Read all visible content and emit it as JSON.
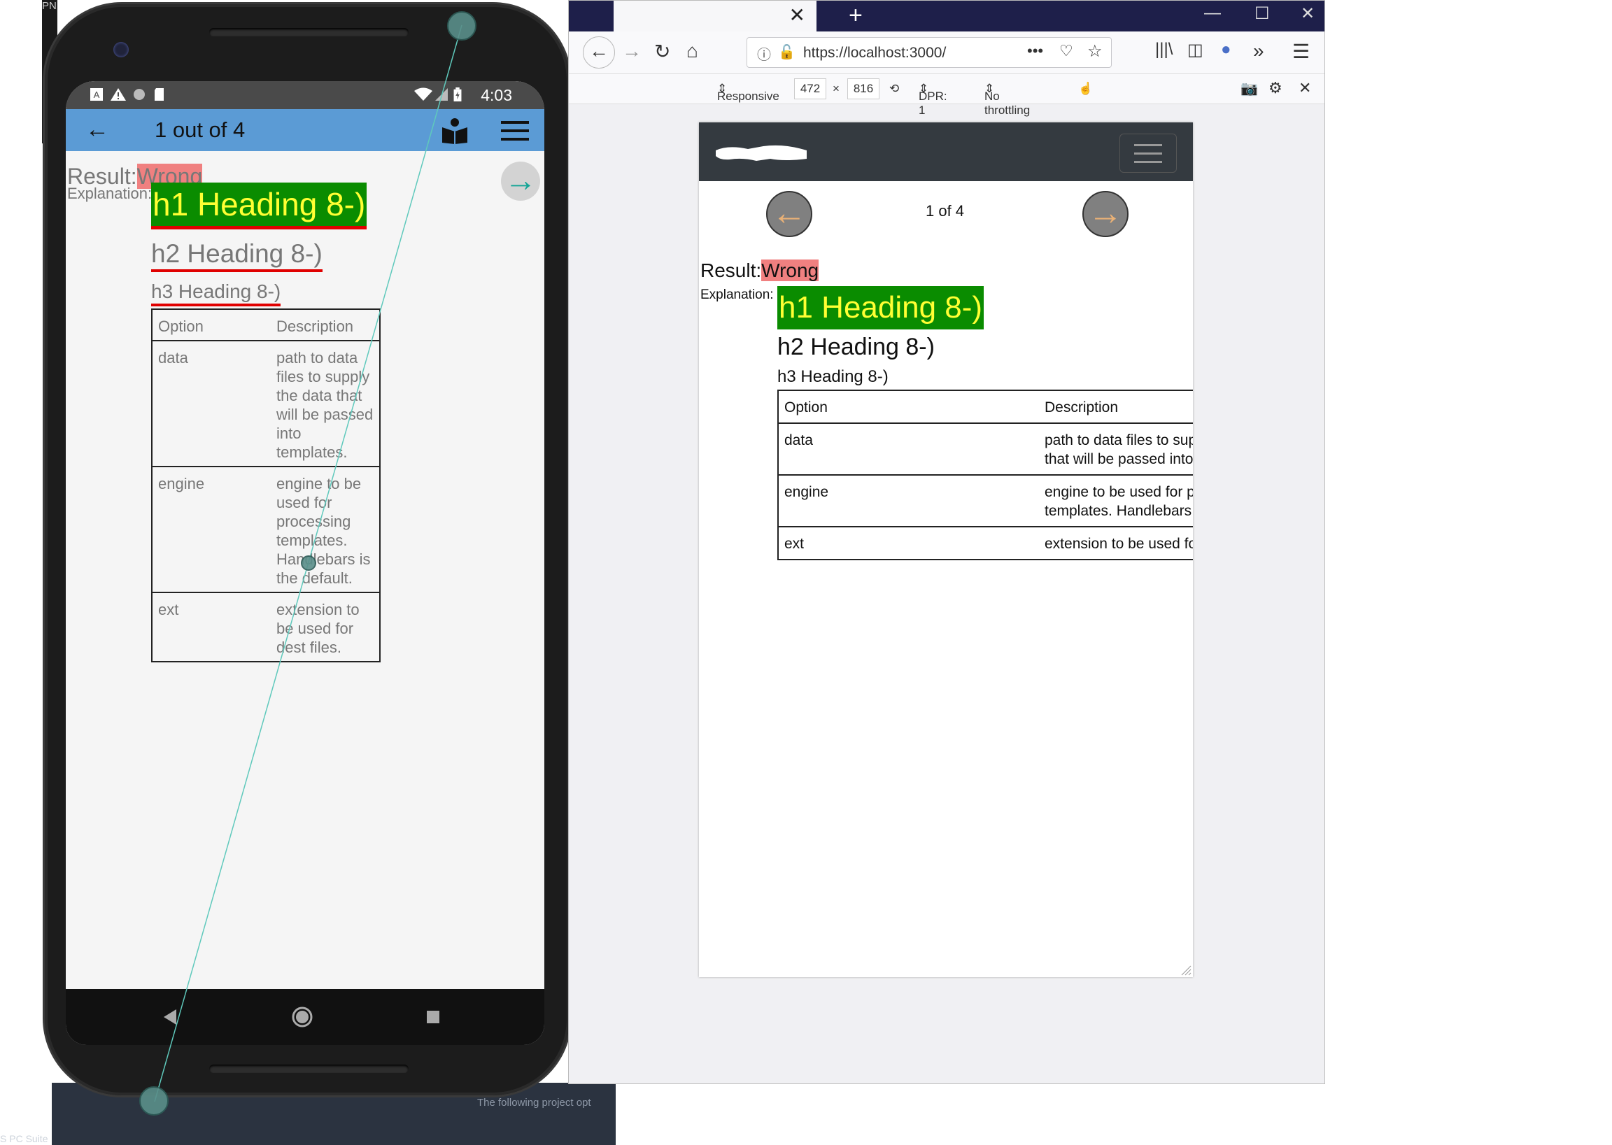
{
  "desktop": {
    "top_fragment": "PN",
    "bottom_fragment": "The following project opt",
    "bottom_left_fragment": "S PC Suite"
  },
  "phone": {
    "status": {
      "time": "4:03"
    },
    "appbar": {
      "title": "1 out of 4"
    },
    "content": {
      "result_label": "Result:",
      "result_value": "Wrong",
      "explanation_label": "Explanation:",
      "h1": "h1 Heading 8-)",
      "h2": "h2 Heading 8-)",
      "h3": "h3 Heading 8-)",
      "table": {
        "headers": [
          "Option",
          "Description"
        ],
        "rows": [
          {
            "option": "data",
            "description": "path to data files to supply the data that will be passed into templates."
          },
          {
            "option": "engine",
            "description": "engine to be used for processing templates. Handlebars is the default."
          },
          {
            "option": "ext",
            "description": "extension to be used for dest files."
          }
        ]
      }
    }
  },
  "browser": {
    "url": "https://localhost:3000/",
    "rdm": {
      "device": "Responsive",
      "width": "472",
      "times": "×",
      "height": "816",
      "dpr": "DPR: 1",
      "throttling": "No throttling"
    },
    "page": {
      "pager": "1 of 4",
      "result_label": "Result:",
      "result_value": "Wrong",
      "explanation_label": "Explanation:",
      "h1": "h1 Heading 8-)",
      "h2": "h2 Heading 8-)",
      "h3": "h3 Heading 8-)",
      "table": {
        "headers": [
          "Option",
          "Description"
        ],
        "rows": [
          {
            "option": "data",
            "line1": "path to data files to sup",
            "line2": "that will be passed into"
          },
          {
            "option": "engine",
            "line1": "engine to be used for p",
            "line2": "templates. Handlebars i"
          },
          {
            "option": "ext",
            "line1": "extension to be used fo",
            "line2": ""
          }
        ]
      }
    }
  },
  "colors": {
    "wrong_bg": "#f08080",
    "h1_bg": "#0a8c00",
    "h1_text": "#ffff33",
    "appbar": "#5b9bd5",
    "navbar_dark": "#343a40"
  }
}
